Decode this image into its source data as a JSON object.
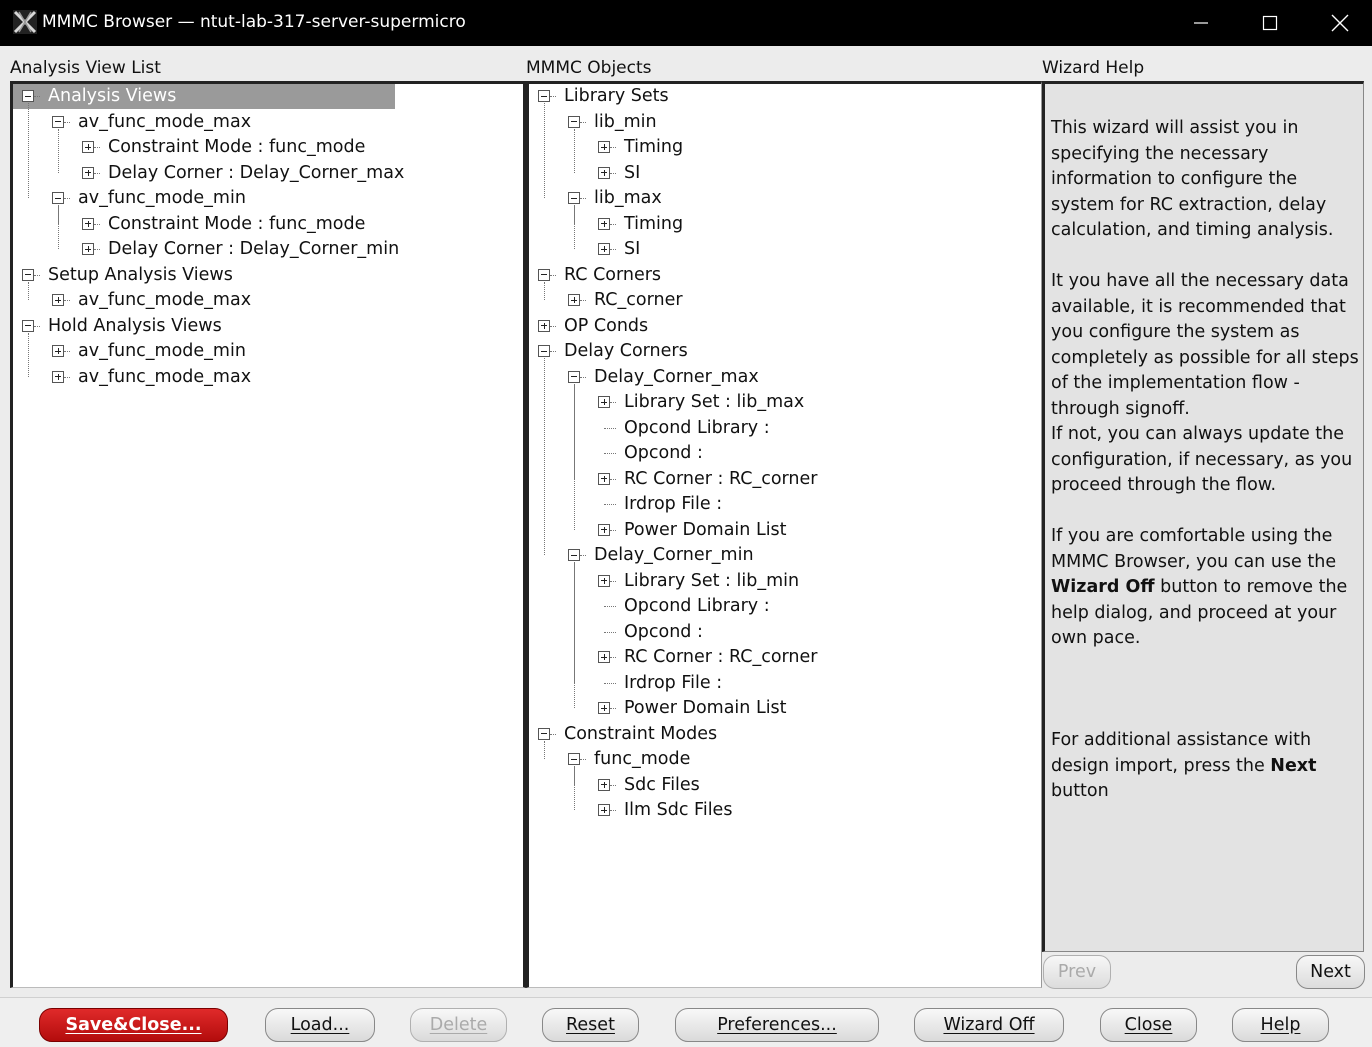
{
  "window": {
    "title": "MMMC Browser — ntut-lab-317-server-supermicro",
    "minimize_glyph": "—",
    "maximize_glyph": "☐",
    "close_glyph": "✕"
  },
  "left_pane": {
    "label": "Analysis View List",
    "nodes": {
      "n0": "Analysis Views",
      "n1": "av_func_mode_max",
      "n2": "Constraint Mode : func_mode",
      "n3": "Delay Corner : Delay_Corner_max",
      "n4": "av_func_mode_min",
      "n5": "Constraint Mode : func_mode",
      "n6": "Delay Corner : Delay_Corner_min",
      "n7": "Setup Analysis Views",
      "n8": "av_func_mode_max",
      "n9": "Hold Analysis Views",
      "n10": "av_func_mode_min",
      "n11": "av_func_mode_max"
    }
  },
  "middle_pane": {
    "label": "MMMC Objects",
    "nodes": {
      "m0": "Library Sets",
      "m1": "lib_min",
      "m2": "Timing",
      "m3": "SI",
      "m4": "lib_max",
      "m5": "Timing",
      "m6": "SI",
      "m7": "RC Corners",
      "m8": "RC_corner",
      "m9": "OP Conds",
      "m10": "Delay Corners",
      "m11": "Delay_Corner_max",
      "m12": "Library Set : lib_max",
      "m13": "Opcond Library :",
      "m14": "Opcond :",
      "m15": "RC Corner : RC_corner",
      "m16": "Irdrop File :",
      "m17": "Power Domain List",
      "m18": "Delay_Corner_min",
      "m19": "Library Set : lib_min",
      "m20": "Opcond Library :",
      "m21": "Opcond :",
      "m22": "RC Corner : RC_corner",
      "m23": "Irdrop File :",
      "m24": "Power Domain List",
      "m25": "Constraint Modes",
      "m26": "func_mode",
      "m27": "Sdc Files",
      "m28": "Ilm Sdc Files"
    }
  },
  "help_pane": {
    "label": "Wizard Help",
    "p1": "This wizard will assist you in specifying the necessary information to configure the system for RC extraction, delay calculation, and timing analysis.",
    "p2": "It you have all the necessary data available, it is recommended that you configure the system as completely as possible for all steps of the implementation flow - through signoff.",
    "p3": "If not, you can always update the configuration, if necessary, as you proceed through the flow.",
    "p4_before": "If you are comfortable using the MMMC Browser, you can use the ",
    "p4_bold": "Wizard Off",
    "p4_after": " button to remove the help dialog, and proceed at your own pace.",
    "p5_before": "For additional assistance with design import, press the ",
    "p5_bold": "Next",
    "p5_after": " button",
    "prev_label": "Prev",
    "next_label": "Next"
  },
  "buttons": {
    "save_close": "Save&Close...",
    "load": "Load...",
    "delete": "Delete",
    "reset": "Reset",
    "preferences": "Preferences...",
    "wizard_off": "Wizard Off",
    "close": "Close",
    "help": "Help"
  },
  "colors": {
    "titlebar": "#000000",
    "selection": "#9a9a9a",
    "save_button": "#c81414",
    "help_background": "#e3e3e3"
  },
  "icons": {
    "app": "mmmc-app-icon",
    "expand": "plus-box-icon",
    "collapse": "minus-box-icon"
  }
}
